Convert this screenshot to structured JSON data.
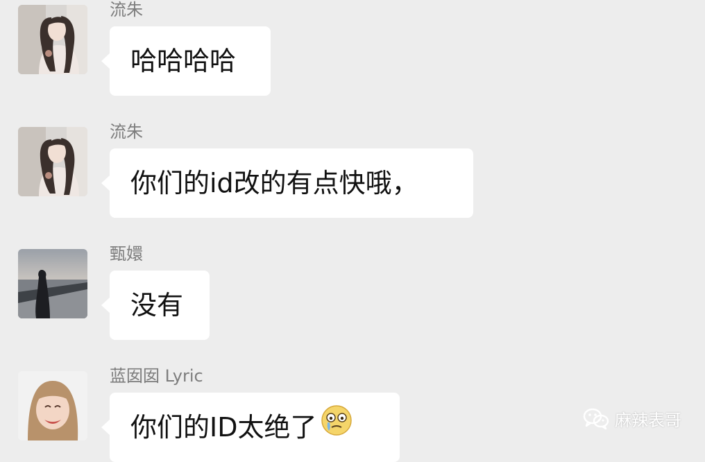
{
  "messages": [
    {
      "sender": "流朱",
      "text": "哈哈哈哈",
      "avatar": "girl-portrait-avatar"
    },
    {
      "sender": "流朱",
      "text": "你们的id改的有点快哦，",
      "avatar": "girl-portrait-avatar"
    },
    {
      "sender": "甄嬛",
      "text": "没有",
      "avatar": "seaside-silhouette-avatar"
    },
    {
      "sender": "蓝囡囡 Lyric",
      "text": "你们的ID太绝了",
      "avatar": "smiling-girl-avatar",
      "emoji": "tearful-emoji"
    }
  ],
  "watermark": {
    "icon": "wechat-icon",
    "text": "麻辣表哥"
  },
  "colors": {
    "background": "#ededed",
    "bubble": "#ffffff",
    "name": "#7d7d7d",
    "text": "#111111"
  }
}
